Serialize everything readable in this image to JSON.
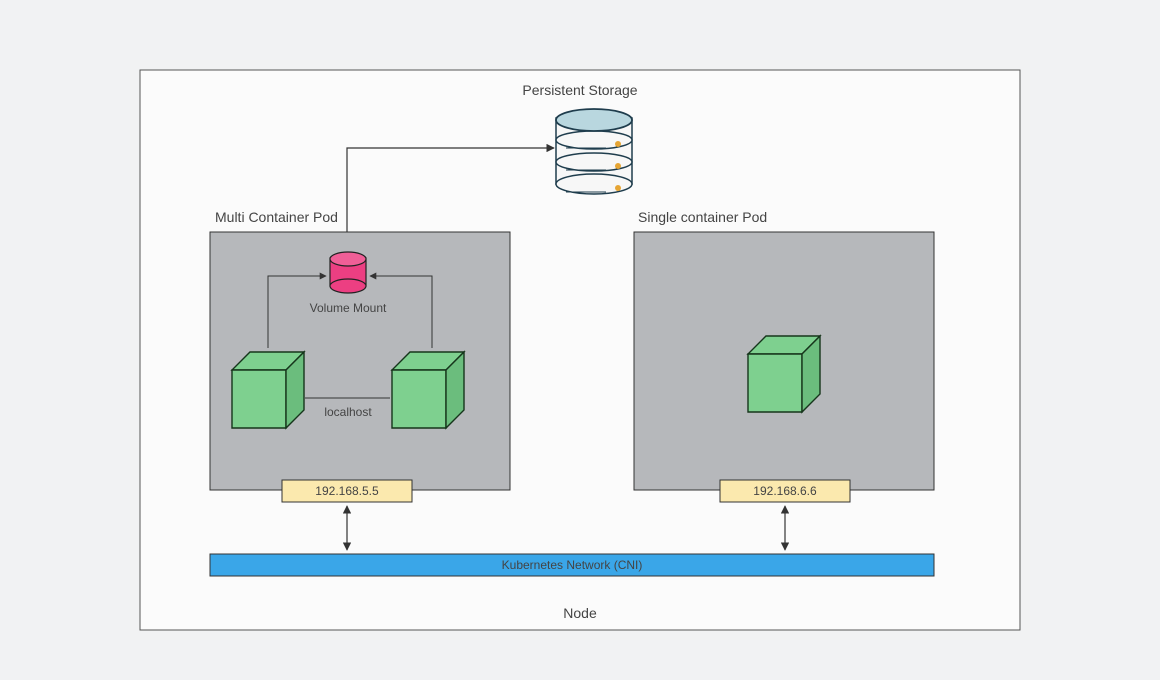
{
  "title": "Persistent Storage",
  "node_label": "Node",
  "network_label": "Kubernetes Network (CNI)",
  "pods": {
    "multi": {
      "title": "Multi Container Pod",
      "ip": "192.168.5.5",
      "volume_label": "Volume Mount",
      "localhost_label": "localhost"
    },
    "single": {
      "title": "Single container Pod",
      "ip": "192.168.6.6"
    }
  },
  "colors": {
    "page_bg": "#f1f2f3",
    "node_fill": "#fbfbfb",
    "pod_fill": "#b6b8bb",
    "ip_fill": "#fbe9ae",
    "network_fill": "#3aa6e8",
    "container_fill": "#7ed08f",
    "container_stroke": "#16351b",
    "volume_fill": "#ec3f82",
    "volume_stroke": "#222",
    "storage_fill": "#b9d7df",
    "storage_body": "#f7f7f7",
    "storage_stroke": "#1f3d4d",
    "dot": "#e6a534",
    "line": "#333"
  }
}
